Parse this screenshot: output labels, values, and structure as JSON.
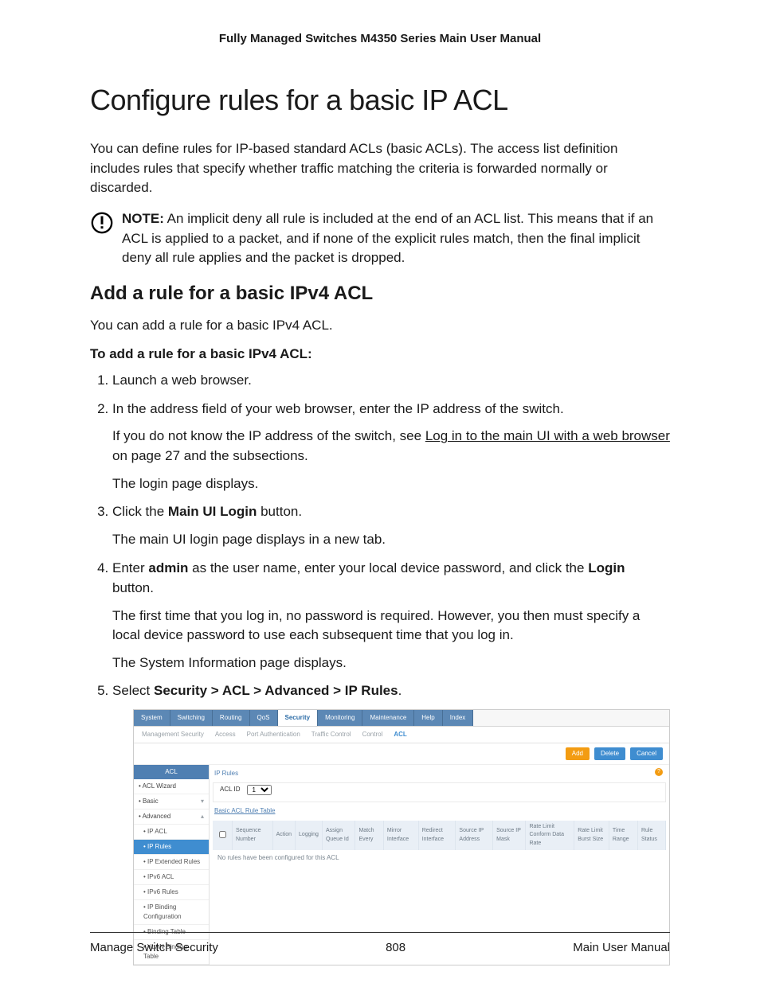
{
  "doc_header": "Fully Managed Switches M4350 Series Main User Manual",
  "h1": "Configure rules for a basic IP ACL",
  "intro": "You can define rules for IP-based standard ACLs (basic ACLs). The access list definition includes rules that specify whether traffic matching the criteria is forwarded normally or discarded.",
  "note": {
    "label": "NOTE:",
    "text": " An implicit deny all rule is included at the end of an ACL list. This means that if an ACL is applied to a packet, and if none of the explicit rules match, then the final implicit deny all rule applies and the packet is dropped."
  },
  "h2": "Add a rule for a basic IPv4 ACL",
  "h2_intro": "You can add a rule for a basic IPv4 ACL.",
  "task": "To add a rule for a basic IPv4 ACL:",
  "steps": {
    "s1": "Launch a web browser.",
    "s2": "In the address field of your web browser, enter the IP address of the switch.",
    "s2a_pre": "If you do not know the IP address of the switch, see ",
    "s2a_link": "Log in to the main UI with a web browser",
    "s2a_post": " on page 27 and the subsections.",
    "s2b": "The login page displays.",
    "s3_pre": "Click the ",
    "s3_b": "Main UI Login",
    "s3_post": " button.",
    "s3a": "The main UI login page displays in a new tab.",
    "s4_pre": "Enter ",
    "s4_b1": "admin",
    "s4_mid": " as the user name, enter your local device password, and click the ",
    "s4_b2": "Login",
    "s4_post": " button.",
    "s4a": "The first time that you log in, no password is required. However, you then must specify a local device password to use each subsequent time that you log in.",
    "s4b": "The System Information page displays.",
    "s5_pre": "Select ",
    "s5_b": "Security > ACL > Advanced > IP Rules",
    "s5_post": "."
  },
  "shot": {
    "tabs": [
      "System",
      "Switching",
      "Routing",
      "QoS",
      "Security",
      "Monitoring",
      "Maintenance",
      "Help",
      "Index"
    ],
    "tabs_sel": "Security",
    "subtabs": [
      "Management Security",
      "Access",
      "Port Authentication",
      "Traffic Control",
      "Control",
      "ACL"
    ],
    "subtabs_sel": "ACL",
    "buttons": {
      "add": "Add",
      "delete": "Delete",
      "cancel": "Cancel"
    },
    "side_header": "ACL",
    "side": [
      {
        "label": "ACL Wizard"
      },
      {
        "label": "Basic",
        "chev": "▾"
      },
      {
        "label": "Advanced",
        "chev": "▴"
      },
      {
        "label": "IP ACL",
        "sub": true
      },
      {
        "label": "IP Rules",
        "sub": true,
        "sel": true
      },
      {
        "label": "IP Extended Rules",
        "sub": true
      },
      {
        "label": "IPv6 ACL",
        "sub": true
      },
      {
        "label": "IPv6 Rules",
        "sub": true
      },
      {
        "label": "IP Binding Configuration",
        "sub": true
      },
      {
        "label": "Binding Table",
        "sub": true
      },
      {
        "label": "VLAN Binding Table",
        "sub": true
      }
    ],
    "section1": "IP Rules",
    "aclid_label": "ACL ID",
    "aclid_value": "1",
    "section2": "Basic ACL Rule Table",
    "cols": [
      "Sequence Number",
      "Action",
      "Logging",
      "Assign Queue Id",
      "Match Every",
      "Mirror Interface",
      "Redirect Interface",
      "Source IP Address",
      "Source IP Mask",
      "Rate Limit Conform Data Rate",
      "Rate Limit Burst Size",
      "Time Range",
      "Rule Status"
    ],
    "empty": "No rules have been configured for this ACL"
  },
  "footer": {
    "left": "Manage Switch Security",
    "center": "808",
    "right": "Main User Manual"
  }
}
